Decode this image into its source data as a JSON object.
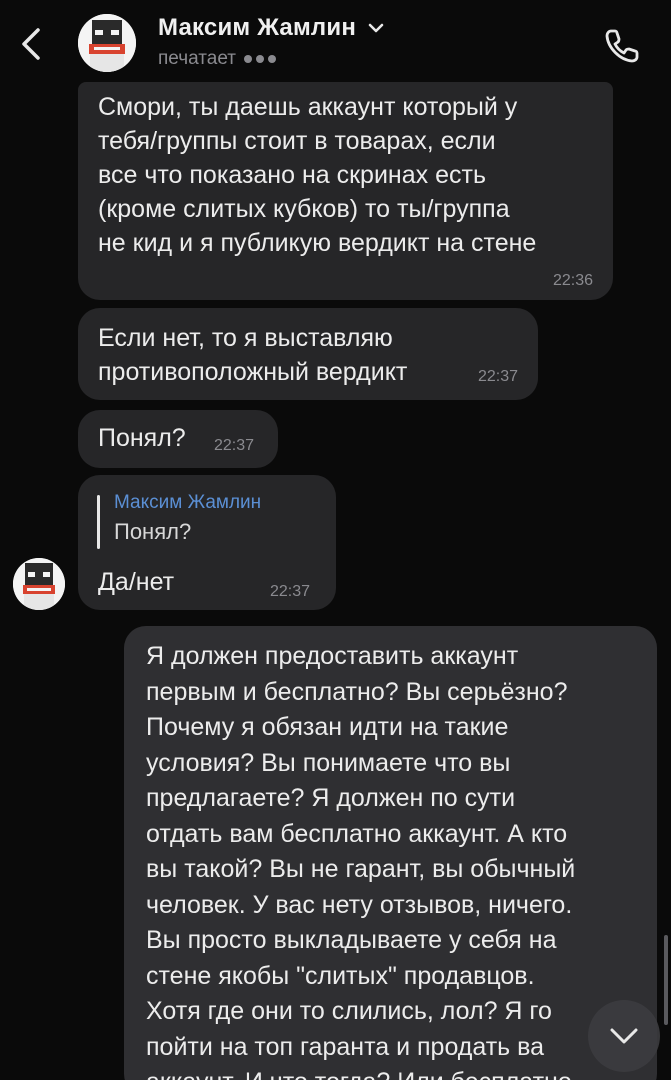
{
  "header": {
    "contact_name": "Максим Жамлин",
    "status": "печатает"
  },
  "messages": [
    {
      "text": "Смори, ты даешь аккаунт который у\nтебя/группы стоит в товарах, если\nвсе что показано на скринах есть\n(кроме слитых кубков) то ты/группа\nне кид и я публикую вердикт на стене",
      "time": "22:36"
    },
    {
      "text": "Если нет, то я выставляю\nпротивоположный вердикт",
      "time": "22:37"
    },
    {
      "text": "Понял?",
      "time": "22:37"
    },
    {
      "reply_author": "Максим Жамлин",
      "reply_text": "Понял?",
      "text": "Да/нет",
      "time": "22:37"
    },
    {
      "text": "Я должен предоставить аккаунт\nпервым и бесплатно? Вы серьёзно?\nПочему я обязан идти на такие\nусловия? Вы понимаете что вы\nпредлагаете? Я должен по сути\nотдать вам бесплатно аккаунт. А кто\nвы такой? Вы не гарант, вы обычный\nчеловек. У вас нету отзывов, ничего.\nВы просто выкладываете у себя на\nстене якобы \"слитых\" продавцов.\nХотя где они то слились, лол? Я го\nпойти на топ гаранта и продать ва\nаккаунт. И что тогда? Или бесплатно"
    }
  ],
  "colors": {
    "background": "#0a0a0a",
    "incoming_bubble": "#262628",
    "outgoing_bubble": "#2f2f32",
    "reply_name": "#5b8fd4",
    "muted": "#8a8a8f"
  },
  "icons": {
    "back": "chevron-left-icon",
    "call": "phone-icon",
    "dropdown": "chevron-down-icon",
    "scroll_down": "chevron-down-icon"
  }
}
